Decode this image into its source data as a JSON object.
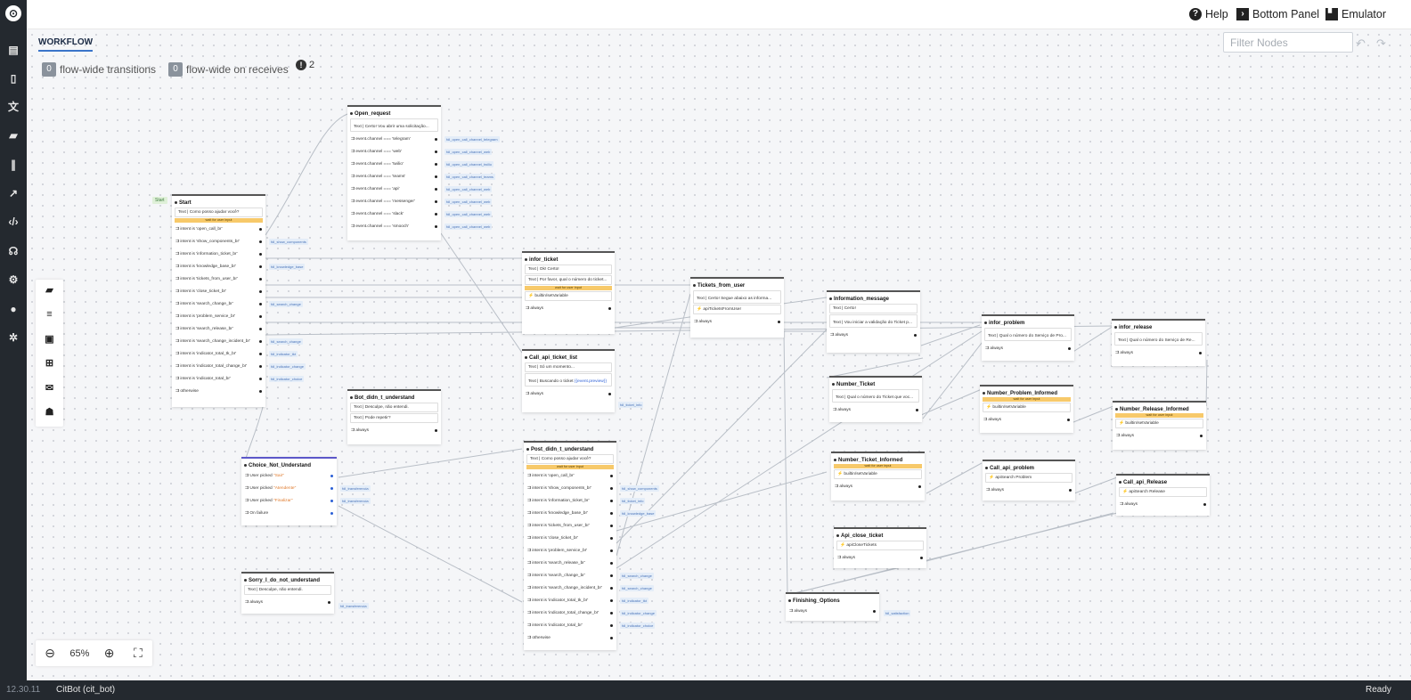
{
  "app": {
    "version": "12.30.11",
    "bot": "CitBot (cit_bot)",
    "status": "Ready"
  },
  "header": {
    "help": "Help",
    "bottom_panel": "Bottom Panel",
    "emulator": "Emulator"
  },
  "toolbar": {
    "tab": "WORKFLOW",
    "flow_transitions_count": "0",
    "flow_transitions_label": "flow-wide transitions",
    "flow_receives_count": "0",
    "flow_receives_label": "flow-wide on receives",
    "warnings_count": "2",
    "filter_placeholder": "Filter Nodes",
    "zoom": "65%"
  },
  "nodes": {
    "start": {
      "start_tag": "Start",
      "title": "Start",
      "say": "Text | Como posso ajudar você?",
      "wait": "wait for user input",
      "transitions": [
        {
          "cond": "⇉ intent is 'open_call_br'",
          "target": ""
        },
        {
          "cond": "⇉ intent is 'show_components_br'",
          "target": "fdl_show_components"
        },
        {
          "cond": "⇉ intent is 'information_ticket_br'",
          "target": ""
        },
        {
          "cond": "⇉ intent is 'knowledge_base_br'",
          "target": "fdl_knowledge_base"
        },
        {
          "cond": "⇉ intent is 'tickets_from_user_br'",
          "target": ""
        },
        {
          "cond": "⇉ intent is 'close_ticket_br'",
          "target": ""
        },
        {
          "cond": "⇉ intent is 'search_change_br'",
          "target": "fdl_search_change"
        },
        {
          "cond": "⇉ intent is 'problem_service_br'",
          "target": ""
        },
        {
          "cond": "⇉ intent is 'search_release_br'",
          "target": ""
        },
        {
          "cond": "⇉ intent is 'search_change_incident_br'",
          "target": "fdl_search_change"
        },
        {
          "cond": "⇉ intent is 'indicator_total_tk_br'",
          "target": "fdl_indicator_tkt"
        },
        {
          "cond": "⇉ intent is 'indicator_total_change_br'",
          "target": "fdl_indicator_change"
        },
        {
          "cond": "⇉ intent is 'indicator_total_br'",
          "target": "fdl_indicator_choice"
        },
        {
          "cond": "⇉ otherwise",
          "target": ""
        }
      ]
    },
    "open_request": {
      "title": "Open_request",
      "say": "Text | Certo! Vou abrir uma solicitação...",
      "transitions": [
        {
          "cond": "⇉ event.channel === 'telegram'",
          "target": "fdl_open_call_channel_telegram"
        },
        {
          "cond": "⇉ event.channel === 'web'",
          "target": "fdl_open_call_channel_web"
        },
        {
          "cond": "⇉ event.channel === 'twilio'",
          "target": "fdl_open_call_channel_twilio"
        },
        {
          "cond": "⇉ event.channel === 'teams'",
          "target": "fdl_open_call_channel_teams"
        },
        {
          "cond": "⇉ event.channel === 'api'",
          "target": "fdl_open_call_channel_web"
        },
        {
          "cond": "⇉ event.channel === 'messenger'",
          "target": "fdl_open_call_channel_web"
        },
        {
          "cond": "⇉ event.channel === 'slack'",
          "target": "fdl_open_call_channel_web"
        },
        {
          "cond": "⇉ event.channel === 'smooch'",
          "target": "fdl_open_call_channel_web"
        }
      ]
    },
    "infor_ticket": {
      "title": "infor_ticket",
      "say1": "Text | Ok! Certo!",
      "say2": "Text | Por favor, qual o número do ticket...",
      "wait": "wait for user input",
      "action": "builtin/setVariable",
      "always": "⇉ always"
    },
    "call_api_ticket_list": {
      "title": "Call_api_ticket_list",
      "say1": "Text | Só um momento...",
      "say2": "Text | Buscando o ticket",
      "say2_var": "{{event.preview}}",
      "always": "⇉ always",
      "target": "fdl_ticket_info"
    },
    "tickets_from_user": {
      "title": "Tickets_from_user",
      "say": "Text | Certo! Segue abaixo as informa...",
      "action": "apiTicketsFromUser",
      "always": "⇉ always"
    },
    "information_message": {
      "title": "Information_message",
      "say1": "Text | Certo!",
      "say2": "Text | Vou iniciar a validação do Ticket p...",
      "always": "⇉ always"
    },
    "infor_problem": {
      "title": "infor_problem",
      "say": "Text | Qual o número do Serviço de Pro...",
      "always": "⇉ always"
    },
    "infor_release": {
      "title": "infor_release",
      "say": "Text | Qual o número do Serviço de Re...",
      "always": "⇉ always"
    },
    "bot_didnt_understand": {
      "title": "Bot_didn_t_understand",
      "say1": "Text | Desculpe, não entendi.",
      "say2": "Text | Pode repetir?",
      "always": "⇉ always"
    },
    "choice_not_understand": {
      "title": "Choice_Not_Understand",
      "transitions": [
        {
          "cond": "⇉ User picked ",
          "value": "\"Sair\"",
          "target": ""
        },
        {
          "cond": "⇉ User picked ",
          "value": "\"Atendente\"",
          "target": "fdl_transferencia"
        },
        {
          "cond": "⇉ User picked ",
          "value": "\"Finalizar\"",
          "target": "fdl_transferencia"
        },
        {
          "cond": "⇉ On failure",
          "value": "",
          "target": ""
        }
      ]
    },
    "sorry": {
      "title": "Sorry_I_do_not_understand",
      "say": "Text | Desculpe, não entendi.",
      "always": "⇉ always",
      "target": "fdl_transferencia"
    },
    "postdidnt": {
      "title": "Post_didn_t_understand",
      "say": "Text | Como posso ajudar você?",
      "wait": "wait for user input",
      "transitions": [
        {
          "cond": "⇉ intent is 'open_call_br'",
          "target": ""
        },
        {
          "cond": "⇉ intent is 'show_components_br'",
          "target": "fdl_show_components"
        },
        {
          "cond": "⇉ intent is 'information_ticket_br'",
          "target": "fdl_ticket_info"
        },
        {
          "cond": "⇉ intent is 'knowledge_base_br'",
          "target": "fdl_knowledge_base"
        },
        {
          "cond": "⇉ intent is 'tickets_from_user_br'",
          "target": ""
        },
        {
          "cond": "⇉ intent is 'close_ticket_br'",
          "target": ""
        },
        {
          "cond": "⇉ intent is 'problem_service_br'",
          "target": ""
        },
        {
          "cond": "⇉ intent is 'search_release_br'",
          "target": ""
        },
        {
          "cond": "⇉ intent is 'search_change_br'",
          "target": "fdl_search_change"
        },
        {
          "cond": "⇉ intent is 'search_change_incident_br'",
          "target": "fdl_search_change"
        },
        {
          "cond": "⇉ intent is 'indicator_total_tk_br'",
          "target": "fdl_indicator_tkt"
        },
        {
          "cond": "⇉ intent is 'indicator_total_change_br'",
          "target": "fdl_indicator_change"
        },
        {
          "cond": "⇉ intent is 'indicator_total_br'",
          "target": "fdl_indicator_choice"
        },
        {
          "cond": "⇉ otherwise",
          "target": ""
        }
      ]
    },
    "number_ticket": {
      "title": "Number_Ticket",
      "say": "Text | Qual o número do Ticket que voc...",
      "always": "⇉ always"
    },
    "number_problem_informed": {
      "title": "Number_Problem_Informed",
      "wait": "wait for user input",
      "action": "builtin/setVariable",
      "always": "⇉ always"
    },
    "number_release_informed": {
      "title": "Number_Release_Informed",
      "wait": "wait for user input",
      "action": "builtin/setVariable",
      "always": "⇉ always"
    },
    "number_ticket_informed": {
      "title": "Number_Ticket_Informed",
      "wait": "wait for user input",
      "action": "builtin/setVariable",
      "always": "⇉ always"
    },
    "call_api_problem": {
      "title": "Call_api_problem",
      "action": "apiSearch Problem",
      "always": "⇉ always"
    },
    "call_api_release": {
      "title": "Call_api_Release",
      "action": "apiSearch Release",
      "always": "⇉ always"
    },
    "api_close_ticket": {
      "title": "Api_close_ticket",
      "action": "apiCloseTickets",
      "always": "⇉ always"
    },
    "finishing_options": {
      "title": "Finishing_Options",
      "always": "⇉ always",
      "target": "fdl_satisfaction"
    }
  }
}
